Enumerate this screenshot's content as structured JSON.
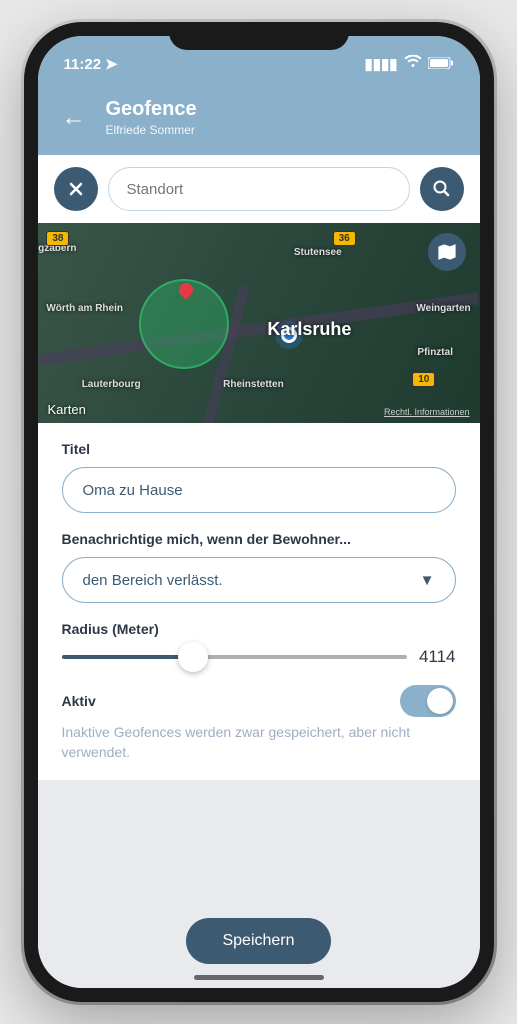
{
  "status": {
    "time": "11:22",
    "location_icon": "▸"
  },
  "header": {
    "title": "Geofence",
    "subtitle": "Elfriede Sommer"
  },
  "search": {
    "placeholder": "Standort"
  },
  "map": {
    "main_city": "Karlsruhe",
    "cities": [
      "ergzabern",
      "Wörth am Rhein",
      "Stutensee",
      "Weingarten",
      "Pfinztal",
      "Lauterbourg",
      "Rheinstetten"
    ],
    "badges": [
      "38",
      "36",
      "10"
    ],
    "attribution": "Karten",
    "legal": "Rechtl. Informationen"
  },
  "form": {
    "title_label": "Titel",
    "title_value": "Oma zu Hause",
    "notify_label": "Benachrichtige mich, wenn der Bewohner...",
    "notify_value": "den Bereich verlässt.",
    "radius_label": "Radius (Meter)",
    "radius_value": "4114",
    "active_label": "Aktiv",
    "active_hint": "Inaktive Geofences werden zwar gespeichert, aber nicht verwendet."
  },
  "actions": {
    "save": "Speichern"
  }
}
